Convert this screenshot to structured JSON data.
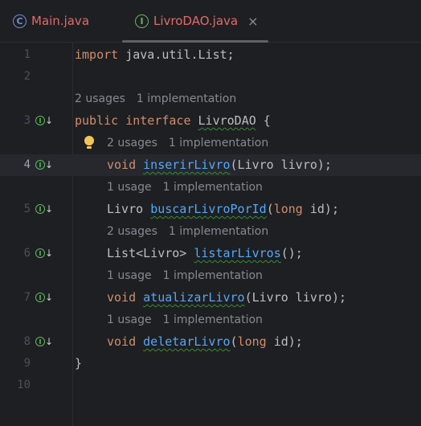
{
  "tabs": [
    {
      "label": "Main.java",
      "icon": "class-icon",
      "icon_glyph": "C",
      "active": false
    },
    {
      "label": "LivroDAO.java",
      "icon": "interface-icon",
      "icon_glyph": "I",
      "active": true,
      "close": "×"
    }
  ],
  "line_numbers": [
    "1",
    "2",
    "3",
    "4",
    "5",
    "6",
    "7",
    "8",
    "9",
    "10"
  ],
  "gutter_icon": {
    "glyph": "I",
    "arrow": "↓"
  },
  "code": {
    "l1": {
      "kw": "import",
      "rest": " java.util.List;"
    },
    "hint_iface": {
      "usages": "2 usages",
      "impl": "1 implementation"
    },
    "l3": {
      "kw1": "public",
      "kw2": "interface",
      "name": "LivroDAO",
      "rest": " {"
    },
    "hint_inserir": {
      "usages": "2 usages",
      "impl": "1 implementation"
    },
    "l4": {
      "ret": "void",
      "name": "inserirLivro",
      "params": "(Livro livro);"
    },
    "hint_buscar": {
      "usages": "1 usage",
      "impl": "1 implementation"
    },
    "l5": {
      "ret": "Livro",
      "name": "buscarLivroPorId",
      "p1": "(",
      "pkw": "long",
      "p2": " id);"
    },
    "hint_listar": {
      "usages": "2 usages",
      "impl": "1 implementation"
    },
    "l6": {
      "ret": "List<Livro>",
      "name": "listarLivros",
      "params": "();"
    },
    "hint_atualizar": {
      "usages": "1 usage",
      "impl": "1 implementation"
    },
    "l7": {
      "ret": "void",
      "name": "atualizarLivro",
      "params": "(Livro livro);"
    },
    "hint_deletar": {
      "usages": "1 usage",
      "impl": "1 implementation"
    },
    "l8": {
      "ret": "void",
      "name": "deletarLivro",
      "p1": "(",
      "pkw": "long",
      "p2": " id);"
    },
    "l9": {
      "text": "}"
    }
  },
  "colors": {
    "background": "#1e1f22",
    "keyword": "#cf8e6d",
    "method": "#56a8f5",
    "tab_text": "#df6b6b",
    "interface_icon": "#5fb85f",
    "class_icon": "#6f8dda"
  }
}
